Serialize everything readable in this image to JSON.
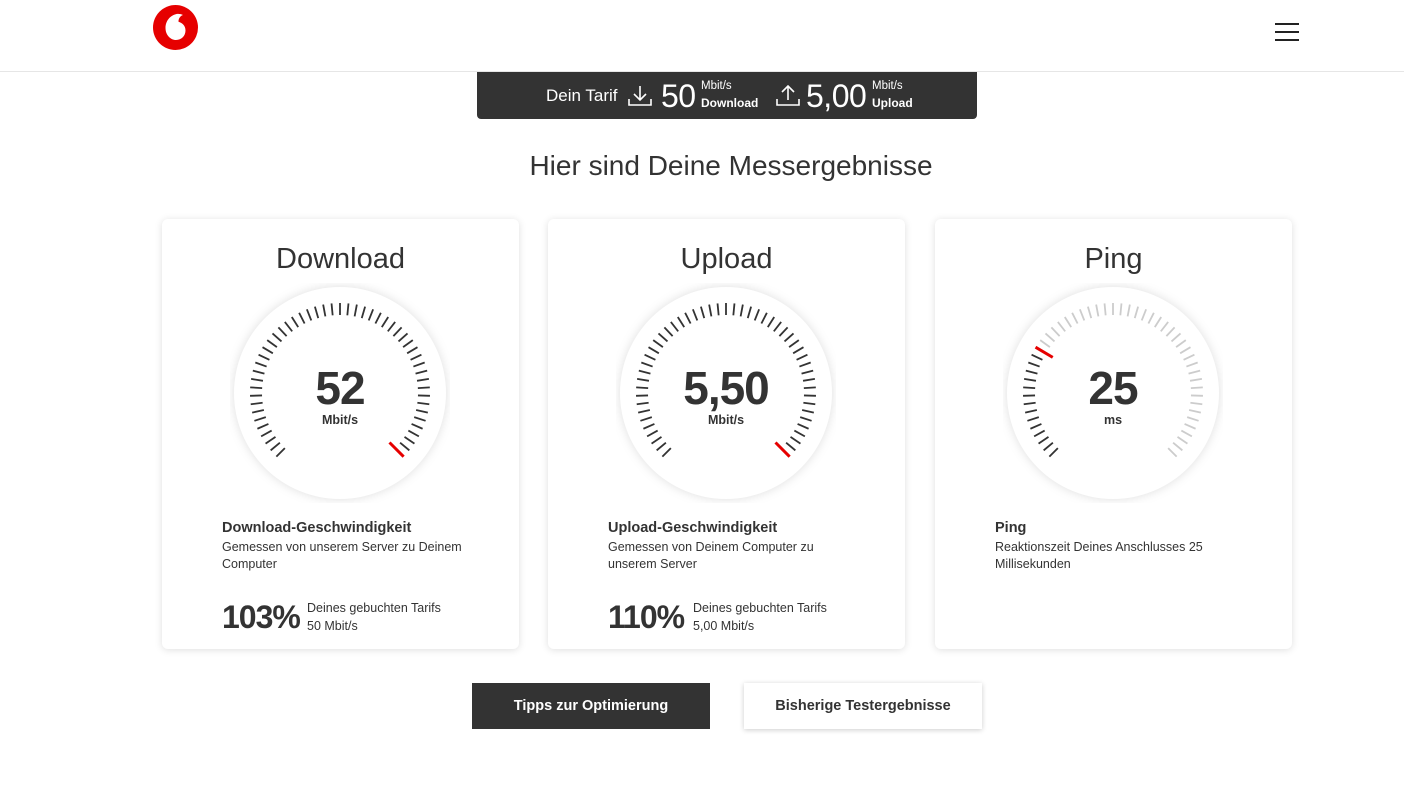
{
  "header": {
    "logo_name": "vodafone-logo",
    "menu_icon": "hamburger-menu-icon"
  },
  "tariff": {
    "label": "Dein Tarif",
    "download_icon": "download-icon",
    "download_value": "50",
    "download_unit": "Mbit/s",
    "download_label": "Download",
    "upload_icon": "upload-icon",
    "upload_value": "5,00",
    "upload_unit": "Mbit/s",
    "upload_label": "Upload"
  },
  "headline": "Hier sind Deine Messergebnisse",
  "cards": [
    {
      "title": "Download",
      "value": "52",
      "unit": "Mbit/s",
      "gauge_fraction": 1.0,
      "desc_title": "Download-Geschwindigkeit",
      "desc_text": "Gemessen von unserem Server zu Deinem Computer",
      "percent": "103%",
      "percent_line1": "Deines gebuchten Tarifs",
      "percent_line2": "50 Mbit/s"
    },
    {
      "title": "Upload",
      "value": "5,50",
      "unit": "Mbit/s",
      "gauge_fraction": 1.0,
      "desc_title": "Upload-Geschwindigkeit",
      "desc_text": "Gemessen von Deinem Computer zu unserem Server",
      "percent": "110%",
      "percent_line1": "Deines gebuchten Tarifs",
      "percent_line2": "5,00 Mbit/s"
    },
    {
      "title": "Ping",
      "value": "25",
      "unit": "ms",
      "gauge_fraction": 0.28,
      "desc_title": "Ping",
      "desc_text": "Reaktionszeit Deines Anschlusses 25 Millisekunden"
    }
  ],
  "buttons": {
    "tips": "Tipps zur Optimierung",
    "history": "Bisherige Testergebnisse"
  },
  "colors": {
    "brand_red": "#e60000",
    "dark": "#333333",
    "tick_active": "#333333",
    "tick_inactive": "#cccccc"
  }
}
